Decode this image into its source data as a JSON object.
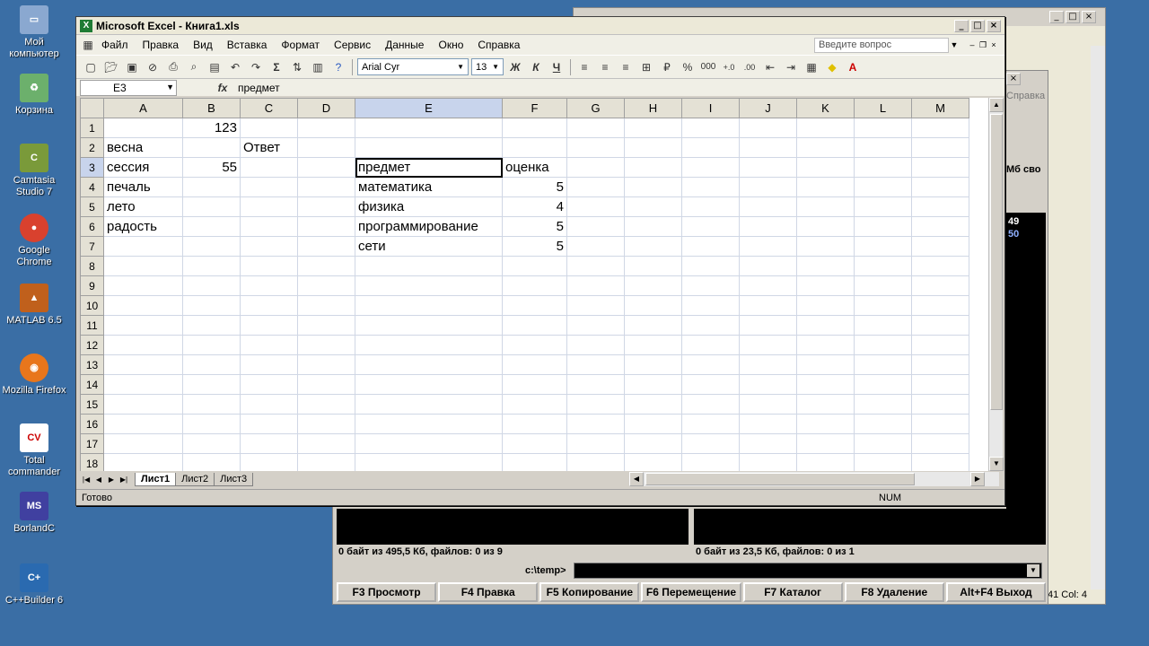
{
  "desktop": {
    "icons": [
      {
        "label": "Мой компьютер"
      },
      {
        "label": "Корзина"
      },
      {
        "label": "Camtasia Studio 7"
      },
      {
        "label": "Google Chrome"
      },
      {
        "label": "MATLAB 6.5"
      },
      {
        "label": "Mozilla Firefox"
      },
      {
        "label": "Total commander"
      },
      {
        "label": "BorlandC"
      },
      {
        "label": "C++Builder 6"
      }
    ]
  },
  "totalcmd": {
    "left_status": "0 байт из 495,5 Кб, файлов: 0 из 9",
    "right_status": "0 байт из 23,5 Кб, файлов: 0 из 1",
    "path": "c:\\temp>",
    "fkeys": [
      "F3 Просмотр",
      "F4 Правка",
      "F5 Копирование",
      "F6 Перемещение",
      "F7 Каталог",
      "F8 Удаление",
      "Alt+F4 Выход"
    ],
    "side_text": "Справка",
    "side_label": "Мб сво",
    "side_num1": "49",
    "side_num2": "50",
    "right_status2": "41 Col: 4"
  },
  "excel": {
    "title": "Microsoft Excel - Книга1.xls",
    "menu": [
      "Файл",
      "Правка",
      "Вид",
      "Вставка",
      "Формат",
      "Сервис",
      "Данные",
      "Окно",
      "Справка"
    ],
    "help_placeholder": "Введите вопрос",
    "font_name": "Arial Cyr",
    "font_size": "13",
    "name_box": "E3",
    "fx_label": "fx",
    "formula_value": "предмет",
    "columns": [
      "A",
      "B",
      "C",
      "D",
      "E",
      "F",
      "G",
      "H",
      "I",
      "J",
      "K",
      "L",
      "M"
    ],
    "rows": [
      [
        "",
        "123",
        "",
        "",
        "",
        "",
        "",
        "",
        "",
        "",
        "",
        "",
        ""
      ],
      [
        "весна",
        "",
        "Ответ",
        "",
        "",
        "",
        "",
        "",
        "",
        "",
        "",
        "",
        ""
      ],
      [
        "сессия",
        "55",
        "",
        "",
        "предмет",
        "оценка",
        "",
        "",
        "",
        "",
        "",
        "",
        ""
      ],
      [
        "печаль",
        "",
        "",
        "",
        "математика",
        "5",
        "",
        "",
        "",
        "",
        "",
        "",
        ""
      ],
      [
        "лето",
        "",
        "",
        "",
        "физика",
        "4",
        "",
        "",
        "",
        "",
        "",
        "",
        ""
      ],
      [
        "радость",
        "",
        "",
        "",
        "программирование",
        "5",
        "",
        "",
        "",
        "",
        "",
        "",
        ""
      ],
      [
        "",
        "",
        "",
        "",
        "сети",
        "5",
        "",
        "",
        "",
        "",
        "",
        "",
        ""
      ],
      [
        "",
        "",
        "",
        "",
        "",
        "",
        "",
        "",
        "",
        "",
        "",
        "",
        ""
      ],
      [
        "",
        "",
        "",
        "",
        "",
        "",
        "",
        "",
        "",
        "",
        "",
        "",
        ""
      ],
      [
        "",
        "",
        "",
        "",
        "",
        "",
        "",
        "",
        "",
        "",
        "",
        "",
        ""
      ],
      [
        "",
        "",
        "",
        "",
        "",
        "",
        "",
        "",
        "",
        "",
        "",
        "",
        ""
      ],
      [
        "",
        "",
        "",
        "",
        "",
        "",
        "",
        "",
        "",
        "",
        "",
        "",
        ""
      ],
      [
        "",
        "",
        "",
        "",
        "",
        "",
        "",
        "",
        "",
        "",
        "",
        "",
        ""
      ],
      [
        "",
        "",
        "",
        "",
        "",
        "",
        "",
        "",
        "",
        "",
        "",
        "",
        ""
      ],
      [
        "",
        "",
        "",
        "",
        "",
        "",
        "",
        "",
        "",
        "",
        "",
        "",
        ""
      ],
      [
        "",
        "",
        "",
        "",
        "",
        "",
        "",
        "",
        "",
        "",
        "",
        "",
        ""
      ],
      [
        "",
        "",
        "",
        "",
        "",
        "",
        "",
        "",
        "",
        "",
        "",
        "",
        ""
      ],
      [
        "",
        "",
        "",
        "",
        "",
        "",
        "",
        "",
        "",
        "",
        "",
        "",
        ""
      ]
    ],
    "sheets": [
      "Лист1",
      "Лист2",
      "Лист3"
    ],
    "status": "Готово",
    "num_indicator": "NUM"
  }
}
